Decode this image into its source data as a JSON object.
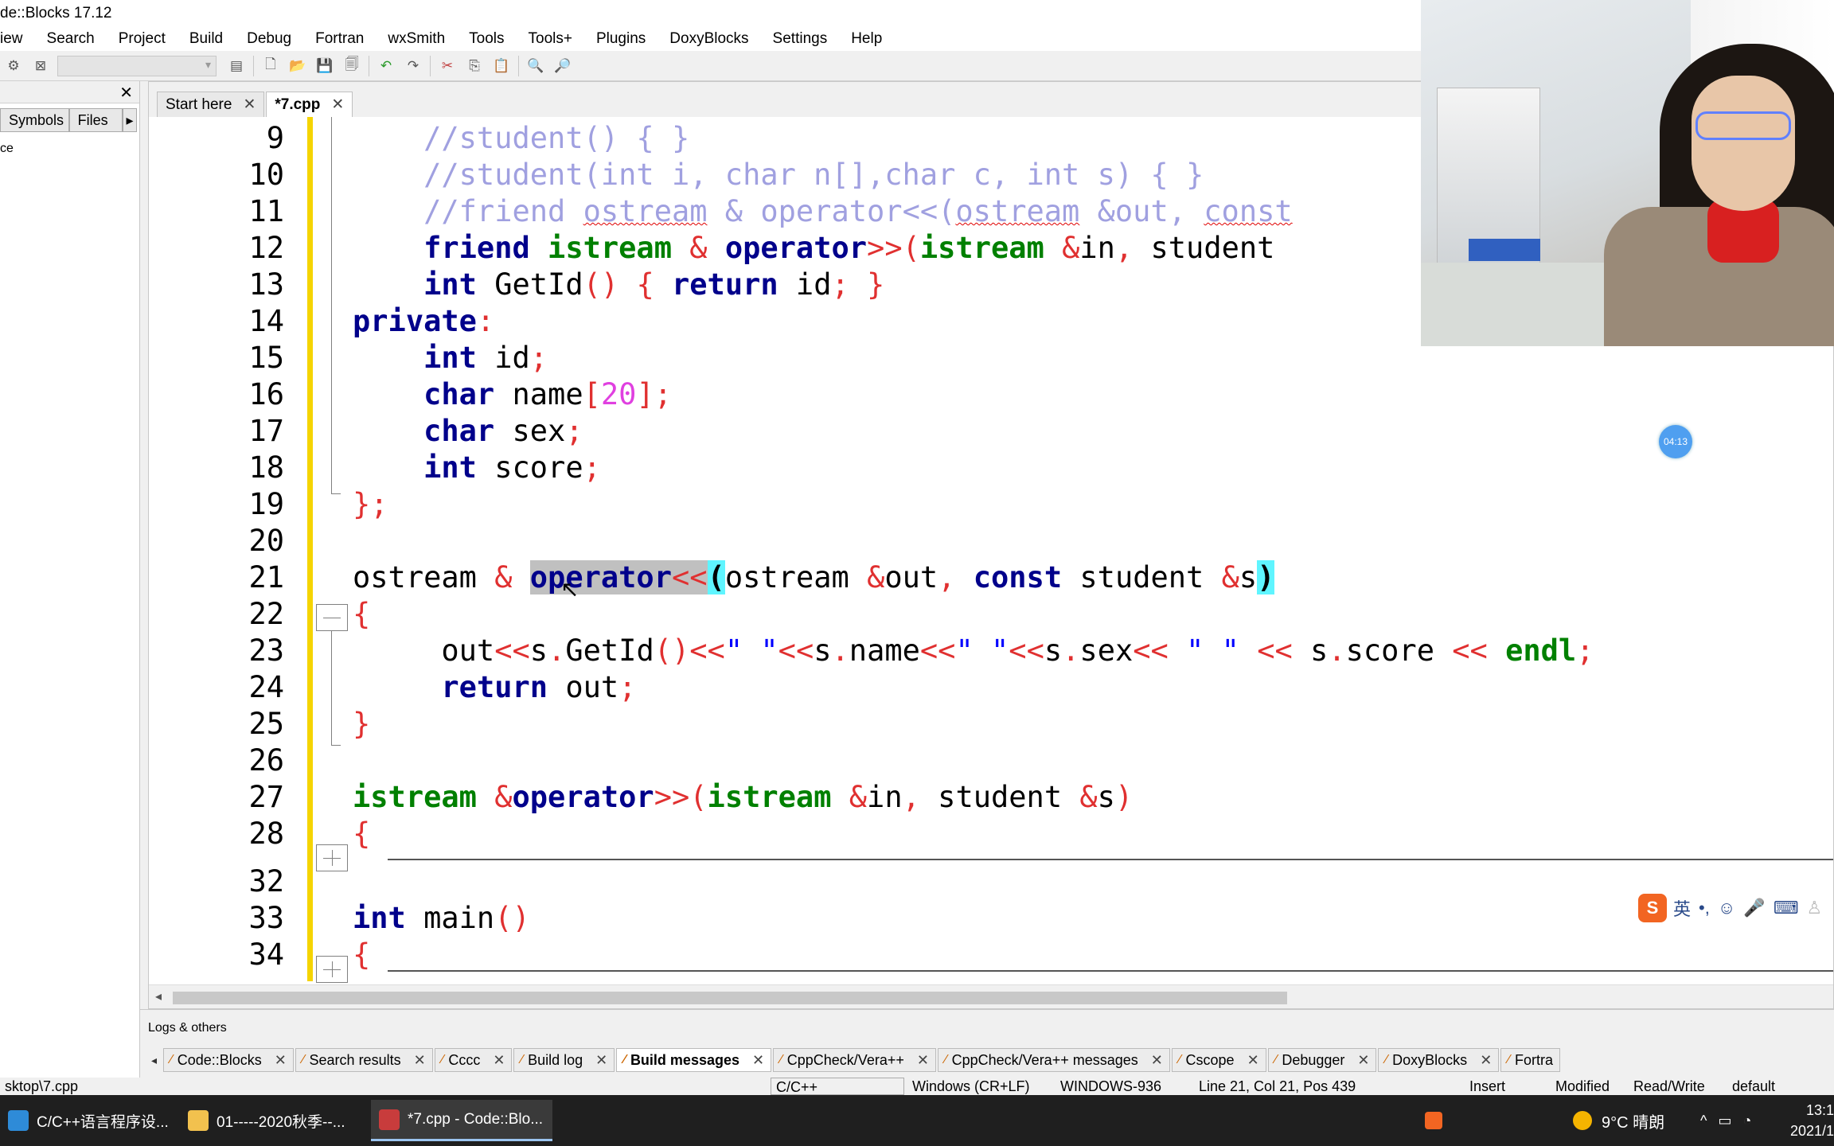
{
  "window": {
    "title": "de::Blocks 17.12"
  },
  "menu": [
    "iew",
    "Search",
    "Project",
    "Build",
    "Debug",
    "Fortran",
    "wxSmith",
    "Tools",
    "Tools+",
    "Plugins",
    "DoxyBlocks",
    "Settings",
    "Help"
  ],
  "management": {
    "tabs": [
      "Symbols",
      "Files"
    ],
    "tree_item": "ce"
  },
  "editor_tabs": [
    {
      "label": "Start here",
      "active": false
    },
    {
      "label": "*7.cpp",
      "active": true
    }
  ],
  "code_lines": [
    {
      "n": "9"
    },
    {
      "n": "10"
    },
    {
      "n": "11"
    },
    {
      "n": "12"
    },
    {
      "n": "13"
    },
    {
      "n": "14"
    },
    {
      "n": "15"
    },
    {
      "n": "16"
    },
    {
      "n": "17"
    },
    {
      "n": "18"
    },
    {
      "n": "19"
    },
    {
      "n": "20"
    },
    {
      "n": "21"
    },
    {
      "n": "22"
    },
    {
      "n": "23"
    },
    {
      "n": "24"
    },
    {
      "n": "25"
    },
    {
      "n": "26"
    },
    {
      "n": "27"
    },
    {
      "n": "28"
    },
    {
      "n": "32"
    },
    {
      "n": "33"
    },
    {
      "n": "34"
    }
  ],
  "logs": {
    "title": "Logs & others",
    "tabs": [
      {
        "label": "Code::Blocks",
        "active": false
      },
      {
        "label": "Search results",
        "active": false
      },
      {
        "label": "Cccc",
        "active": false
      },
      {
        "label": "Build log",
        "active": false
      },
      {
        "label": "Build messages",
        "active": true
      },
      {
        "label": "CppCheck/Vera++",
        "active": false
      },
      {
        "label": "CppCheck/Vera++ messages",
        "active": false
      },
      {
        "label": "Cscope",
        "active": false
      },
      {
        "label": "Debugger",
        "active": false
      },
      {
        "label": "DoxyBlocks",
        "active": false
      },
      {
        "label": "Fortra",
        "active": false
      }
    ]
  },
  "status": {
    "path": "sktop\\7.cpp",
    "lang": "C/C++",
    "eol": "Windows (CR+LF)",
    "encoding": "WINDOWS-936",
    "position": "Line 21, Col 21, Pos 439",
    "mode": "Insert",
    "modified": "Modified",
    "access": "Read/Write",
    "profile": "default"
  },
  "taskbar": {
    "items": [
      {
        "label": "C/C++语言程序设...",
        "active": false,
        "color": "#2e8bd8"
      },
      {
        "label": "01-----2020秋季--...",
        "active": false,
        "color": "#f2c14e"
      },
      {
        "label": "*7.cpp - Code::Blo...",
        "active": true,
        "color": "#c83c3c"
      }
    ],
    "weather": "9°C 晴朗",
    "time": "13:1",
    "date": "2021/1"
  },
  "overlay": {
    "timer": "04:13",
    "ime_label": "英"
  }
}
